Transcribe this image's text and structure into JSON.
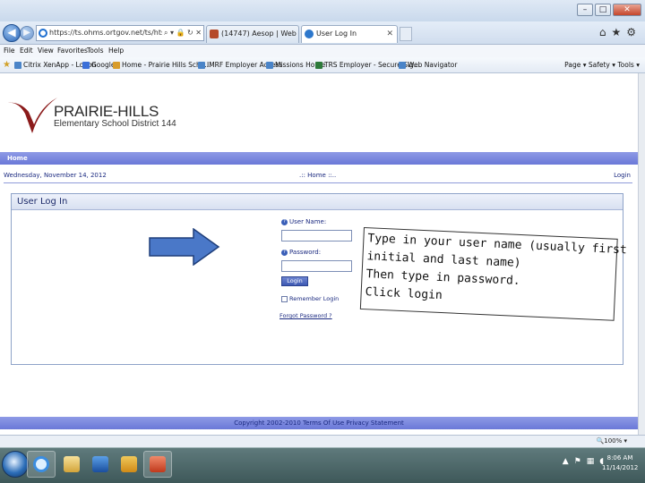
{
  "browser": {
    "url": "https://ts.ohms.ortgov.net/ts/hts144s..",
    "tabs": [
      {
        "label": "(14747) Aesop | Web Navigator"
      },
      {
        "label": "User Log In"
      }
    ],
    "menu": [
      "File",
      "Edit",
      "View",
      "Favorites",
      "Tools",
      "Help"
    ],
    "favorites": [
      "Citrix XenApp - Logon",
      "Google",
      "Home - Prairie Hills Scho...",
      "IMRF Employer Access",
      "Missions Home",
      "TRS Employer - Secure Sig...",
      "Web Navigator"
    ],
    "command_bar": "Page ▾  Safety ▾  Tools ▾",
    "zoom": "100%"
  },
  "site": {
    "name": "PRAIRIE-HILLS",
    "subtitle": "Elementary School District 144",
    "nav_home": "Home",
    "date": "Wednesday, November 14, 2012",
    "breadcrumb": ".:: Home ::..",
    "login_link": "Login",
    "footer": "Copyright 2002-2010   Terms Of Use   Privacy Statement"
  },
  "login_panel": {
    "title": "User Log In",
    "username_label": "User Name:",
    "password_label": "Password:",
    "login_button": "Login",
    "remember_label": "Remember Login",
    "forgot_link": "Forgot Password ?"
  },
  "callout": {
    "lines": [
      "Type in your user name (usually first",
      "initial and last name)",
      "Then type in password.",
      "Click login"
    ]
  },
  "taskbar": {
    "time": "8:06 AM",
    "date": "11/14/2012"
  },
  "colors": {
    "nav_bar": "#7b88de",
    "text_blue": "#1b2a80",
    "logo_red": "#8b1a1a",
    "arrow_blue": "#4a78c8"
  }
}
